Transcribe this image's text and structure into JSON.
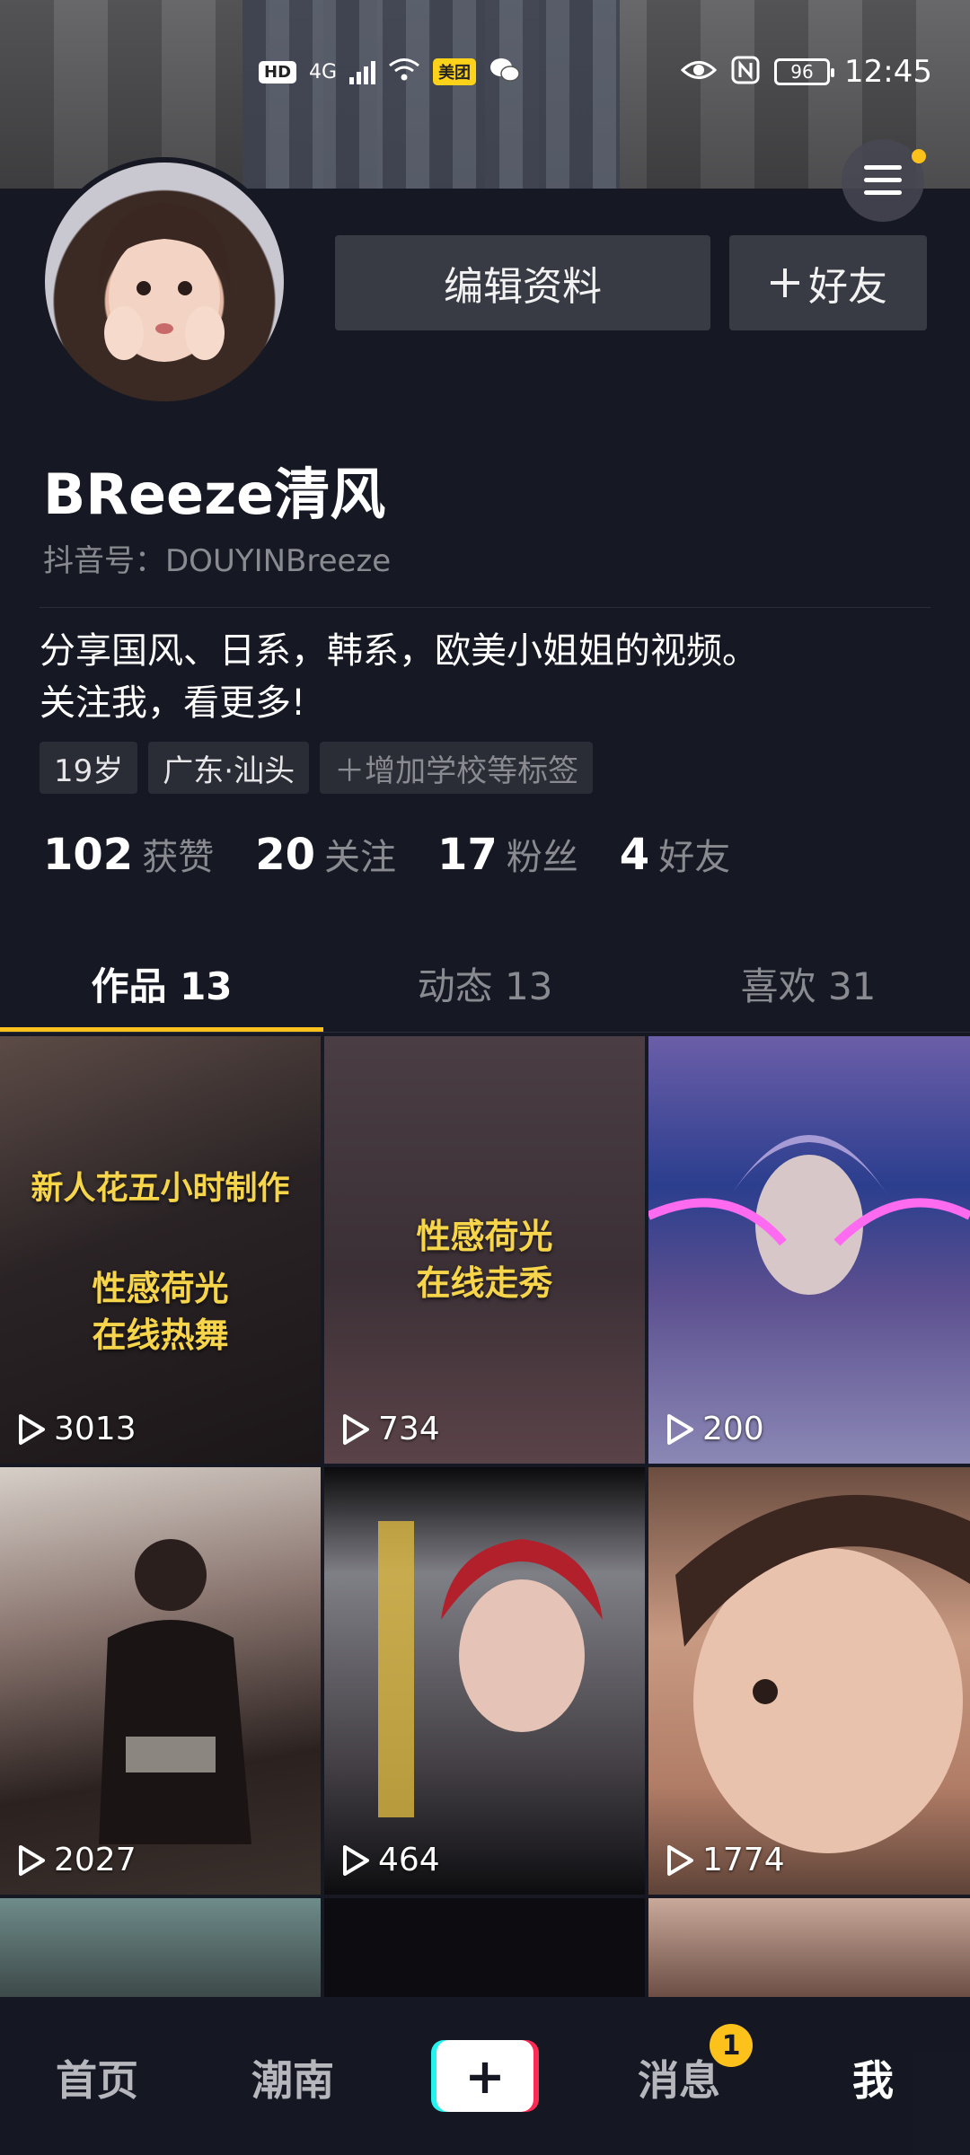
{
  "status_bar": {
    "hd_label": "HD",
    "network_label": "4G",
    "app_badge": "美团",
    "battery_level": "96",
    "time": "12:45"
  },
  "profile": {
    "edit_button": "编辑资料",
    "add_friend_button": "好友",
    "username": "BReeze清风",
    "douyin_id": "抖音号：DOUYINBreeze",
    "bio_line1": "分享国风、日系，韩系，欧美小姐姐的视频。",
    "bio_line2": "关注我，看更多!",
    "tags": [
      "19岁",
      "广东·汕头",
      "＋增加学校等标签"
    ],
    "stats": [
      {
        "num": "102",
        "label": "获赞"
      },
      {
        "num": "20",
        "label": "关注"
      },
      {
        "num": "17",
        "label": "粉丝"
      },
      {
        "num": "4",
        "label": "好友"
      }
    ]
  },
  "tabs": [
    "作品 13",
    "动态 13",
    "喜欢 31"
  ],
  "videos": [
    {
      "views": "3013",
      "caption_lines": [
        "新人花五小时制作",
        "性感荷光",
        "在线热舞"
      ]
    },
    {
      "views": "734",
      "caption_lines": [
        "性感荷光",
        "在线走秀"
      ]
    },
    {
      "views": "200",
      "caption_lines": []
    },
    {
      "views": "2027",
      "caption_lines": []
    },
    {
      "views": "464",
      "caption_lines": []
    },
    {
      "views": "1774",
      "caption_lines": []
    }
  ],
  "bottom_nav": {
    "home": "首页",
    "trend": "潮南",
    "plus": "+",
    "messages": "消息",
    "messages_badge": "1",
    "me": "我"
  },
  "colors": {
    "background": "#161823",
    "accent": "#fcc21b",
    "button": "#393b44"
  }
}
